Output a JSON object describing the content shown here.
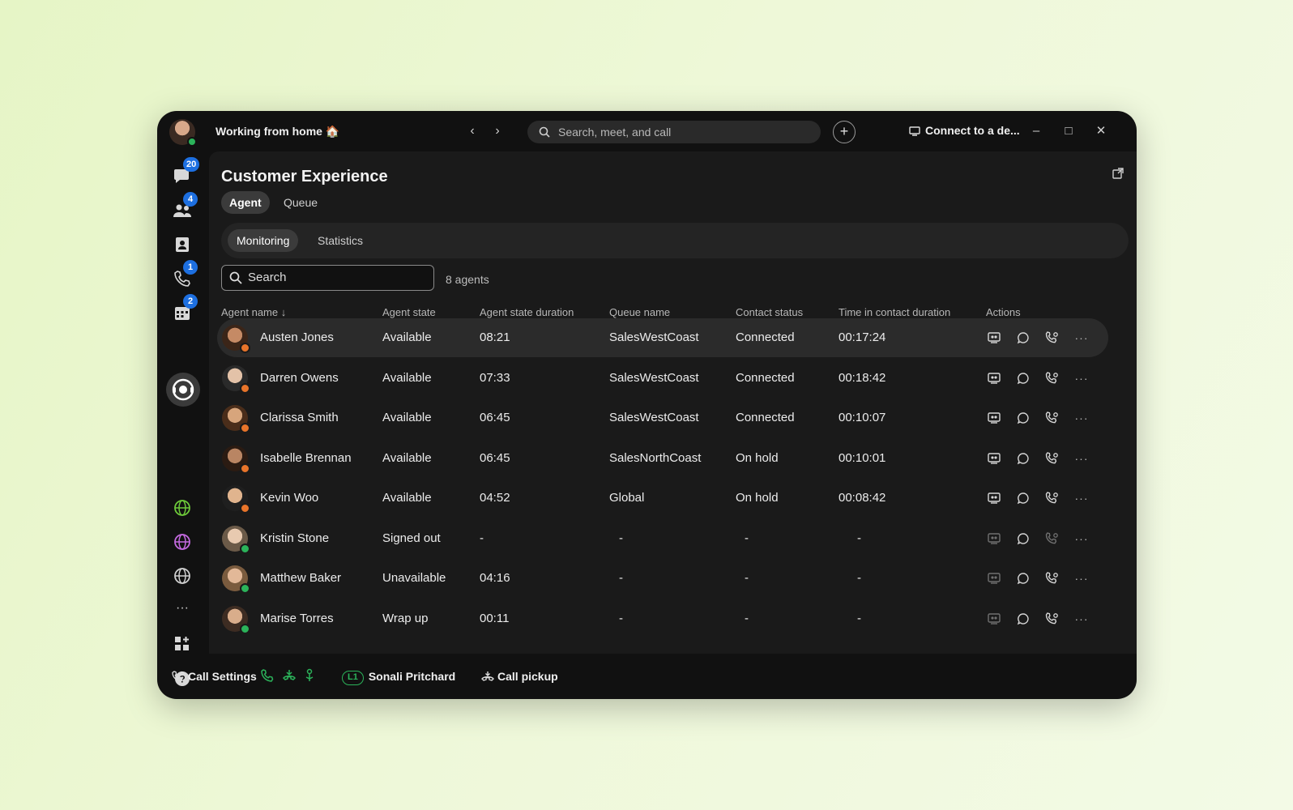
{
  "titlebar": {
    "status": "Working from home 🏠",
    "search_placeholder": "Search, meet, and call",
    "connect_label": "Connect to a de..."
  },
  "rail": {
    "messaging_badge": "20",
    "teams_badge": "4",
    "calling_badge": "1",
    "meetings_badge": "2"
  },
  "page": {
    "title": "Customer Experience",
    "tabs": [
      "Agent",
      "Queue"
    ],
    "subtabs": [
      "Monitoring",
      "Statistics"
    ],
    "search_placeholder": "Search",
    "agent_count": "8 agents"
  },
  "table": {
    "columns": [
      "Agent name ↓",
      "Agent state",
      "Agent state duration",
      "Queue name",
      "Contact status",
      "Time in contact duration",
      "Actions"
    ],
    "rows": [
      {
        "name": "Austen Jones",
        "state": "Available",
        "duration": "08:21",
        "queue": "SalesWestCoast",
        "contact": "Connected",
        "time": "00:17:24"
      },
      {
        "name": "Darren Owens",
        "state": "Available",
        "duration": "07:33",
        "queue": "SalesWestCoast",
        "contact": "Connected",
        "time": "00:18:42"
      },
      {
        "name": "Clarissa Smith",
        "state": "Available",
        "duration": "06:45",
        "queue": "SalesWestCoast",
        "contact": "Connected",
        "time": "00:10:07"
      },
      {
        "name": "Isabelle Brennan",
        "state": "Available",
        "duration": "06:45",
        "queue": "SalesNorthCoast",
        "contact": "On hold",
        "time": "00:10:01"
      },
      {
        "name": "Kevin Woo",
        "state": "Available",
        "duration": "04:52",
        "queue": "Global",
        "contact": "On hold",
        "time": "00:08:42"
      },
      {
        "name": "Kristin Stone",
        "state": "Signed out",
        "duration": "-",
        "queue": "-",
        "contact": "-",
        "time": "-"
      },
      {
        "name": "Matthew Baker",
        "state": "Unavailable",
        "duration": "04:16",
        "queue": "-",
        "contact": "-",
        "time": "-"
      },
      {
        "name": "Marise Torres",
        "state": "Wrap up",
        "duration": "00:11",
        "queue": "-",
        "contact": "-",
        "time": "-"
      }
    ]
  },
  "bottombar": {
    "call_settings": "Call Settings",
    "line_tag": "L1",
    "line_user": "Sonali Pritchard",
    "call_pickup": "Call pickup"
  },
  "colors": {
    "window_bg": "#111111",
    "content_bg": "#1a1a1a",
    "badge_blue": "#1d6fe0",
    "presence_green": "#2bb35a",
    "presence_orange": "#e8742a"
  }
}
